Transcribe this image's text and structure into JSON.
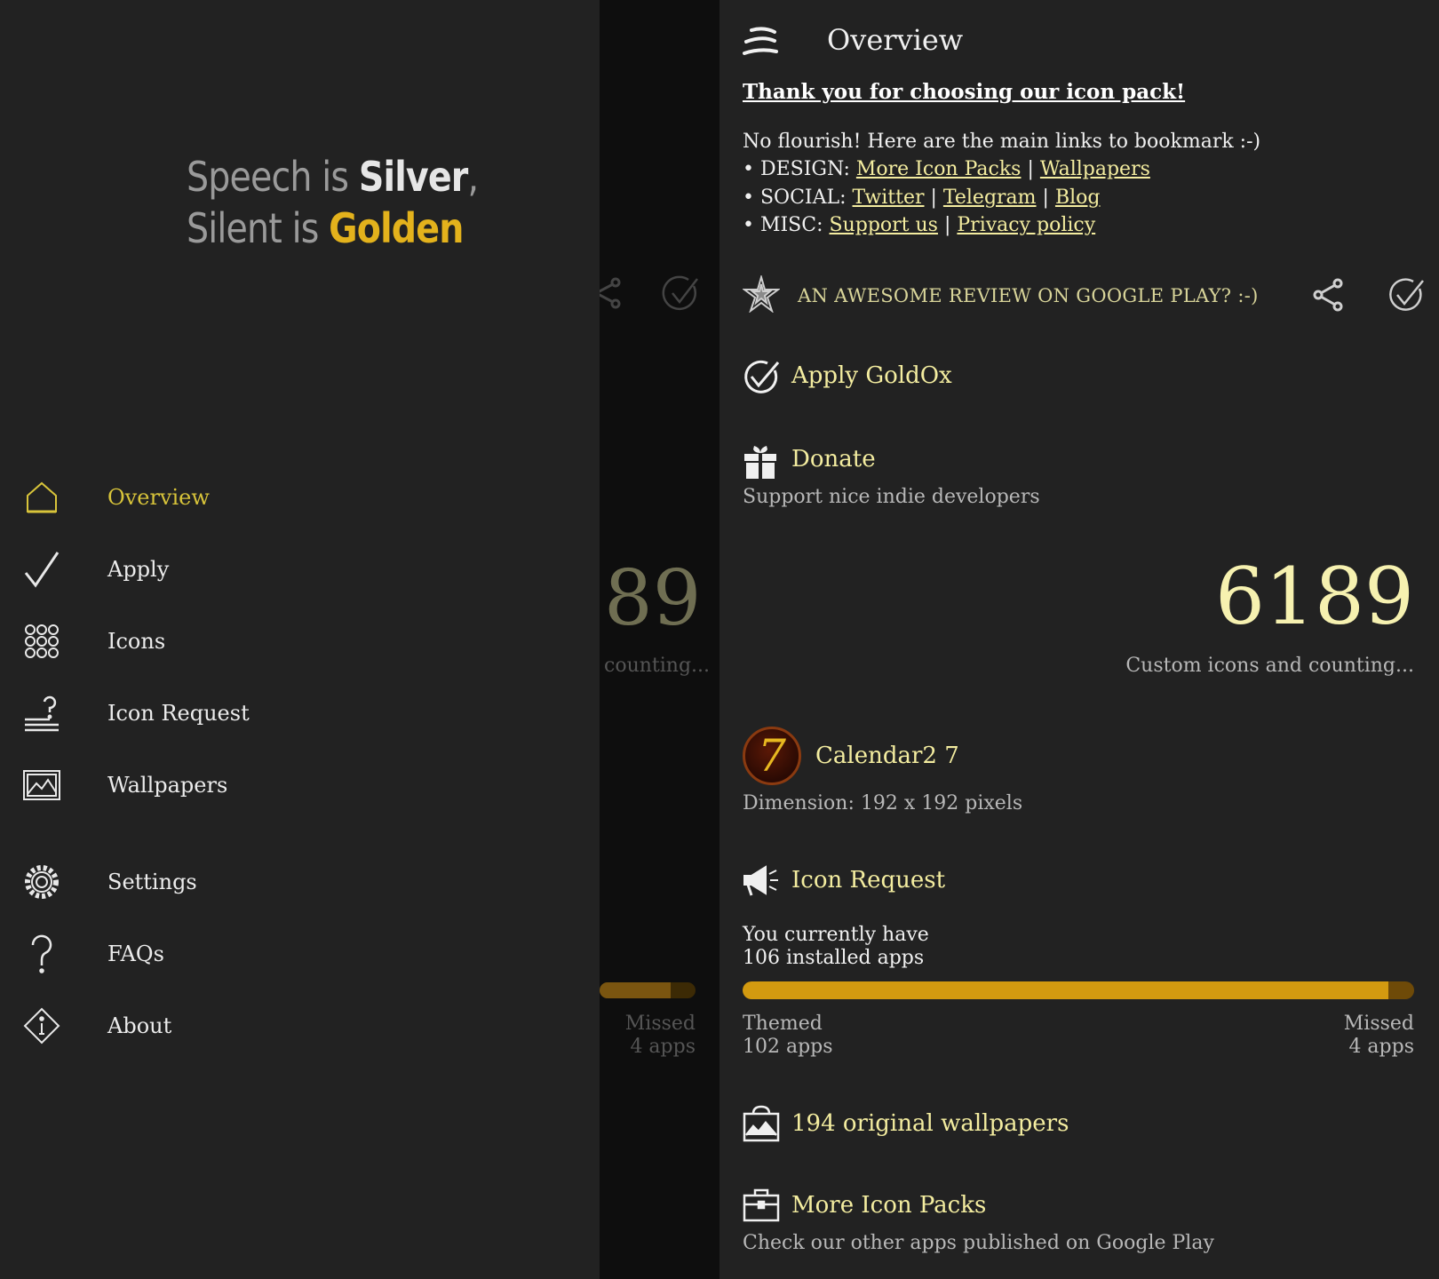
{
  "drawer": {
    "logo": {
      "line1_a": "Speech is ",
      "line1_b": "Silver",
      "line1_c": ",",
      "line2_a": "Silent is ",
      "line2_b": "Golden"
    },
    "items": [
      {
        "label": "Overview",
        "icon": "home-icon"
      },
      {
        "label": "Apply",
        "icon": "checkmark-icon"
      },
      {
        "label": "Icons",
        "icon": "grid-icon"
      },
      {
        "label": "Icon Request",
        "icon": "icon-request-icon"
      },
      {
        "label": "Wallpapers",
        "icon": "image-icon"
      },
      {
        "label": "Settings",
        "icon": "gear-icon"
      },
      {
        "label": "FAQs",
        "icon": "question-icon"
      },
      {
        "label": "About",
        "icon": "info-icon"
      }
    ]
  },
  "underlay": {
    "number": "89",
    "counting": "counting...",
    "missed_label": "Missed",
    "missed_count": "4 apps",
    "progress": 0.74
  },
  "main": {
    "title": "Overview",
    "thanks": "Thank you for choosing our icon pack!",
    "intro": "No flourish! Here are the main links to bookmark :-)",
    "design_prefix": "• DESIGN: ",
    "design_links": [
      "More Icon Packs",
      "Wallpapers"
    ],
    "social_prefix": "• SOCIAL: ",
    "social_links": [
      "Twitter",
      "Telegram",
      "Blog"
    ],
    "misc_prefix": "• MISC: ",
    "misc_links": [
      "Support us",
      "Privacy policy"
    ],
    "separator": " | ",
    "review_text": "AN AWESOME REVIEW ON GOOGLE PLAY? :-)",
    "apply_title": "Apply GoldOx",
    "donate_title": "Donate",
    "donate_sub": "Support nice indie developers",
    "icon_count": "6189",
    "icon_count_sub": "Custom icons and counting...",
    "calendar_title": "Calendar2 7",
    "calendar_glyph": "7",
    "calendar_sub": "Dimension: 192 x 192 pixels",
    "request_title": "Icon Request",
    "installed_line1": "You currently have",
    "installed_line2": "106 installed apps",
    "themed_label": "Themed",
    "themed_count": "102 apps",
    "missed_label": "Missed",
    "missed_count": "4 apps",
    "progress_fraction": 0.962,
    "wallpapers_title": "194 original wallpapers",
    "more_packs_title": "More Icon Packs",
    "more_packs_sub": "Check our other apps published on Google Play"
  },
  "colors": {
    "accent_gold": "#d39a10",
    "title_yellow": "#f4eda0",
    "active_nav": "#d8c43a",
    "background": "#222222"
  }
}
